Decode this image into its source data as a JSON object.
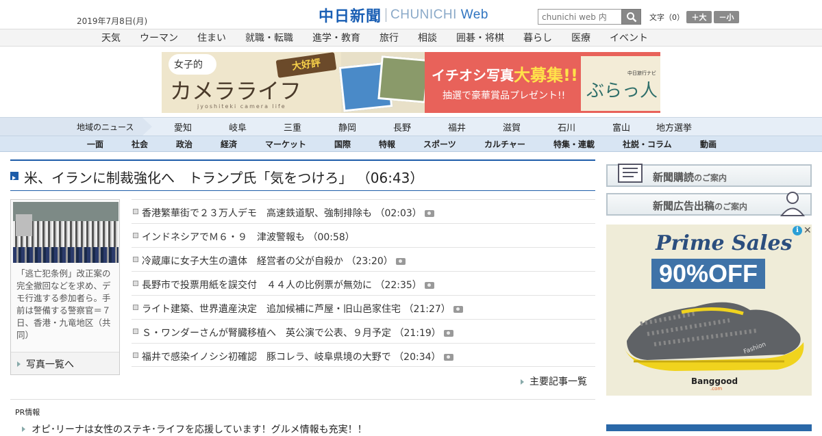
{
  "header": {
    "date": "2019年7月8日(月)",
    "logo_jp": "中日新聞",
    "logo_en": "CHUNICHI",
    "logo_web": "Web",
    "search_placeholder": "chunichi web 内",
    "font_size_label": "文字（0）",
    "font_larger": "＋大",
    "font_smaller": "－小"
  },
  "top_nav": [
    "天気",
    "ウーマン",
    "住まい",
    "就職・転職",
    "進学・教育",
    "旅行",
    "相談",
    "囲碁・将棋",
    "暮らし",
    "医療",
    "イベント"
  ],
  "banner": {
    "title": "カメラライフ",
    "prefix": "女子的",
    "sub": "jyoshiteki camera life",
    "badge": "大好評",
    "headline_a": "イチオシ写真",
    "headline_b": "大募集!!",
    "prize": "抽選で豪華賞品プレゼント!!",
    "brand_small": "中日旅行ナビ",
    "brand": "ぶらっ人"
  },
  "region_nav": {
    "label": "地域のニュース",
    "items": [
      "愛知",
      "岐阜",
      "三重",
      "静岡",
      "長野",
      "福井",
      "滋賀",
      "石川",
      "富山",
      "地方選挙"
    ]
  },
  "section_nav": [
    "一面",
    "社会",
    "政治",
    "経済",
    "マーケット",
    "国際",
    "特報",
    "スポーツ",
    "カルチャー",
    "特集・連載",
    "社説・コラム",
    "動画"
  ],
  "top_story": {
    "headline": "米、イランに制裁強化へ　トランプ氏「気をつけろ」",
    "time": "（06:43）"
  },
  "photo": {
    "caption": "「逃亡犯条例」改正案の完全撤回などを求め、デモ行進する参加者ら。手前は警備する警察官＝７日、香港・九竜地区（共同）",
    "link": "写真一覧へ"
  },
  "news": [
    {
      "title": "香港繁華街で２３万人デモ　高速鉄道駅、強制排除も",
      "time": "（02:03）"
    },
    {
      "title": "インドネシアでＭ６・９　津波警報も",
      "time": "（00:58）"
    },
    {
      "title": "冷蔵庫に女子大生の遺体　経営者の父が自殺か",
      "time": "（23:20）"
    },
    {
      "title": "長野市で投票用紙を誤交付　４４人の比例票が無効に",
      "time": "（22:35）"
    },
    {
      "title": "ライト建築、世界遺産決定　追加候補に芦屋・旧山邑家住宅",
      "time": "（21:27）"
    },
    {
      "title": "Ｓ・ワンダーさんが腎臓移植へ　英公演で公表、９月予定",
      "time": "（21:19）"
    },
    {
      "title": "福井で感染イノシシ初確認　豚コレラ、岐阜県境の大野で",
      "time": "（20:34）"
    }
  ],
  "more_link": "主要記事一覧",
  "pr": {
    "label": "PR情報",
    "text": "オピ･リーナは女性のステキ･ライフを応援しています！グルメ情報も充実！！"
  },
  "sidebar": {
    "subscribe_main": "新聞購読",
    "subscribe_suffix": "のご案内",
    "advert_main": "新聞広告出稿",
    "advert_suffix": "のご案内"
  },
  "ad": {
    "heading": "Prime Sales",
    "discount": "90%OFF",
    "shoe_text": "Fashion",
    "brand": "Banggood",
    "brand_domain": ".com"
  }
}
